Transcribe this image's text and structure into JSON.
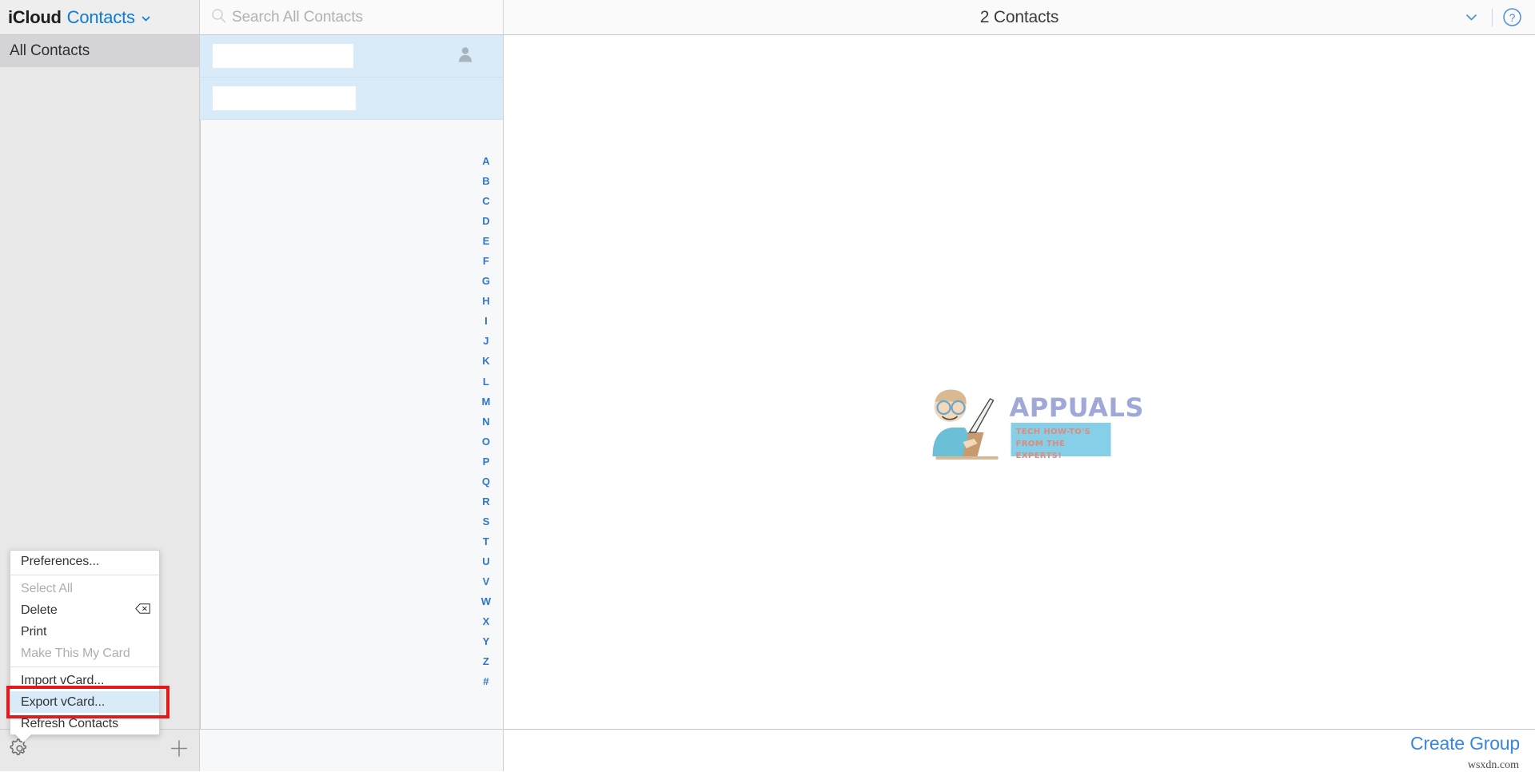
{
  "header": {
    "brand_icloud": "iCloud",
    "brand_app": "Contacts",
    "brand_chevron_icon": "chevron-down-icon",
    "search": {
      "icon": "search-icon",
      "value": "",
      "placeholder": "Search All Contacts"
    },
    "title": "2 Contacts",
    "right_icons": [
      {
        "name": "chevron-down-icon",
        "color": "#4a90d9"
      },
      {
        "name": "help-circle-icon",
        "color": "#4a90d9"
      }
    ]
  },
  "sidebar": {
    "items": [
      {
        "label": "All Contacts",
        "selected": true
      }
    ],
    "bottom": {
      "settings_icon": "gear-icon",
      "add_icon": "plus-icon"
    }
  },
  "contact_list": {
    "rows": [
      {
        "name": "",
        "redacted": true,
        "redact_width": 176,
        "avatar_icon": "person-icon",
        "has_avatar": true,
        "selected": true
      },
      {
        "name": "",
        "redacted": true,
        "redact_width": 179,
        "avatar_icon": "person-icon",
        "has_avatar": false,
        "selected": true
      }
    ],
    "alphabet_index": [
      "A",
      "B",
      "C",
      "D",
      "E",
      "F",
      "G",
      "H",
      "I",
      "J",
      "K",
      "L",
      "M",
      "N",
      "O",
      "P",
      "Q",
      "R",
      "S",
      "T",
      "U",
      "V",
      "W",
      "X",
      "Y",
      "Z",
      "#"
    ]
  },
  "detail": {
    "watermark": {
      "brand": "APPUALS",
      "tagline": "TECH HOW-TO'S FROM THE EXPERTS!"
    }
  },
  "footer": {
    "create_group": "Create Group",
    "site_watermark": "wsxdn.com"
  },
  "context_menu": {
    "visible": true,
    "groups": [
      [
        {
          "label": "Preferences...",
          "disabled": false,
          "highlighted": false,
          "shortcut": ""
        }
      ],
      [
        {
          "label": "Select All",
          "disabled": true,
          "highlighted": false,
          "shortcut": ""
        },
        {
          "label": "Delete",
          "disabled": false,
          "highlighted": false,
          "shortcut": "delete-key-icon"
        },
        {
          "label": "Print",
          "disabled": false,
          "highlighted": false,
          "shortcut": ""
        },
        {
          "label": "Make This My Card",
          "disabled": true,
          "highlighted": false,
          "shortcut": ""
        }
      ],
      [
        {
          "label": "Import vCard...",
          "disabled": false,
          "highlighted": false,
          "shortcut": ""
        },
        {
          "label": "Export vCard...",
          "disabled": false,
          "highlighted": true,
          "shortcut": ""
        },
        {
          "label": "Refresh Contacts",
          "disabled": false,
          "highlighted": false,
          "shortcut": ""
        }
      ]
    ]
  },
  "annotation": {
    "highlight_box_color": "#e01b1b"
  },
  "colors": {
    "accent_blue": "#0b7bd4",
    "link_blue": "#3787e0",
    "selection_blue": "#d9ebf8",
    "sidebar_gray": "#e8e8e8",
    "sidebar_selected": "#d4d4d6",
    "index_blue": "#3076c9"
  }
}
